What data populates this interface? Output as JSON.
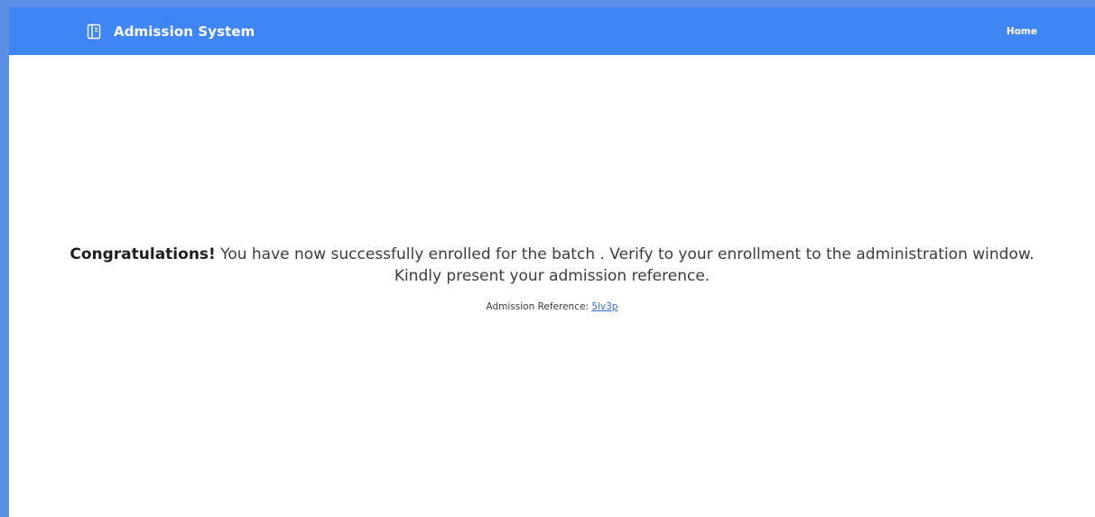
{
  "navbar": {
    "brand_title": "Admission System",
    "brand_icon": "notebook-icon",
    "home_label": "Home",
    "background_color": "#3f86f4"
  },
  "confirmation": {
    "headline": "Congratulations!",
    "message": " You have now successfully enrolled for the batch . Verify to your enrollment to the administration window. Kindly present your admission reference.",
    "reference_label": "Admission Reference: ",
    "reference_value": "5lv3p"
  }
}
